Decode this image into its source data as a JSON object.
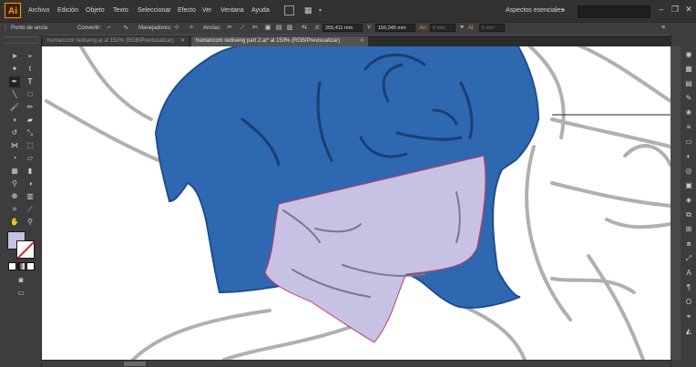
{
  "app": {
    "logo": "Ai"
  },
  "menubar": {
    "items": [
      "Archivo",
      "Edición",
      "Objeto",
      "Texto",
      "Seleccionar",
      "Efecto",
      "Ver",
      "Ventana",
      "Ayuda"
    ],
    "workspace": "Aspectos esenciales"
  },
  "controlbar": {
    "anchor_label": "Punto de ancla",
    "convert_label": "Convertir:",
    "handles_label": "Manejadores:",
    "anchors_label": "Anclas:",
    "x_label": "X:",
    "x_value": "255,411 mm",
    "y_label": "Y:",
    "y_value": "156,045 mm",
    "w_label": "An:",
    "w_value": "0 mm",
    "h_label": "Al:",
    "h_value": "0 mm"
  },
  "tabs": [
    {
      "label": "humancom rediseng.ai al 150% (RGB/Previsualizar)",
      "active": false
    },
    {
      "label": "humancom rediseng part 2.ai* al 150% (RGB/Previsualizar)",
      "active": true
    }
  ],
  "colors": {
    "fill": "#c7c1e4",
    "hair_blue": "#2e68b1",
    "hair_outline": "#1f4e8c",
    "path_outline": "#c23a6a",
    "sketch_gray": "#b0b0b0"
  },
  "tools": [
    "selection-tool",
    "direct-selection-tool",
    "magic-wand-tool",
    "lasso-tool",
    "pen-tool",
    "type-tool",
    "line-tool",
    "rectangle-tool",
    "paintbrush-tool",
    "pencil-tool",
    "blob-brush-tool",
    "eraser-tool",
    "rotate-tool",
    "scale-tool",
    "width-tool",
    "free-transform-tool",
    "shape-builder-tool",
    "perspective-tool",
    "mesh-tool",
    "gradient-tool",
    "eyedropper-tool",
    "blend-tool",
    "symbol-sprayer-tool",
    "graph-tool",
    "artboard-tool",
    "slice-tool",
    "hand-tool",
    "zoom-tool"
  ]
}
